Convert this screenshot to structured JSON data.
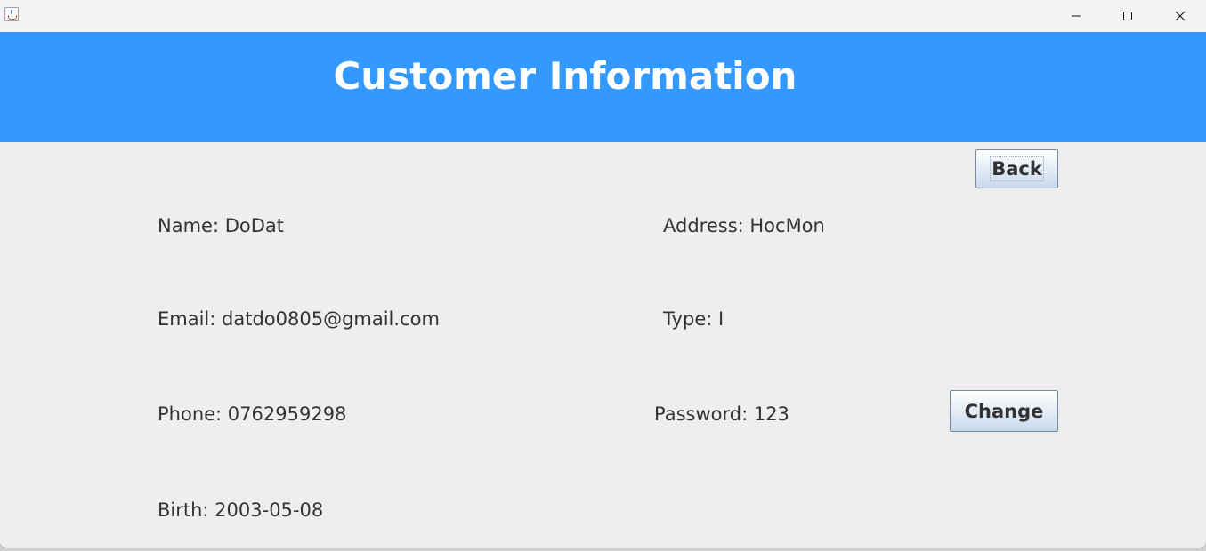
{
  "window": {
    "controls": {
      "minimize_icon": "minimize-icon",
      "maximize_icon": "maximize-icon",
      "close_icon": "close-icon"
    }
  },
  "header": {
    "title": "Customer Information",
    "background_color": "#3399ff"
  },
  "buttons": {
    "back_label": "Back",
    "change_label": "Change"
  },
  "fields": {
    "name": "Name: DoDat",
    "email": "Email: datdo0805@gmail.com",
    "phone": "Phone: 0762959298",
    "birth": "Birth: 2003-05-08",
    "address": "Address: HocMon",
    "type": "Type: I",
    "password": "Password: 123"
  }
}
